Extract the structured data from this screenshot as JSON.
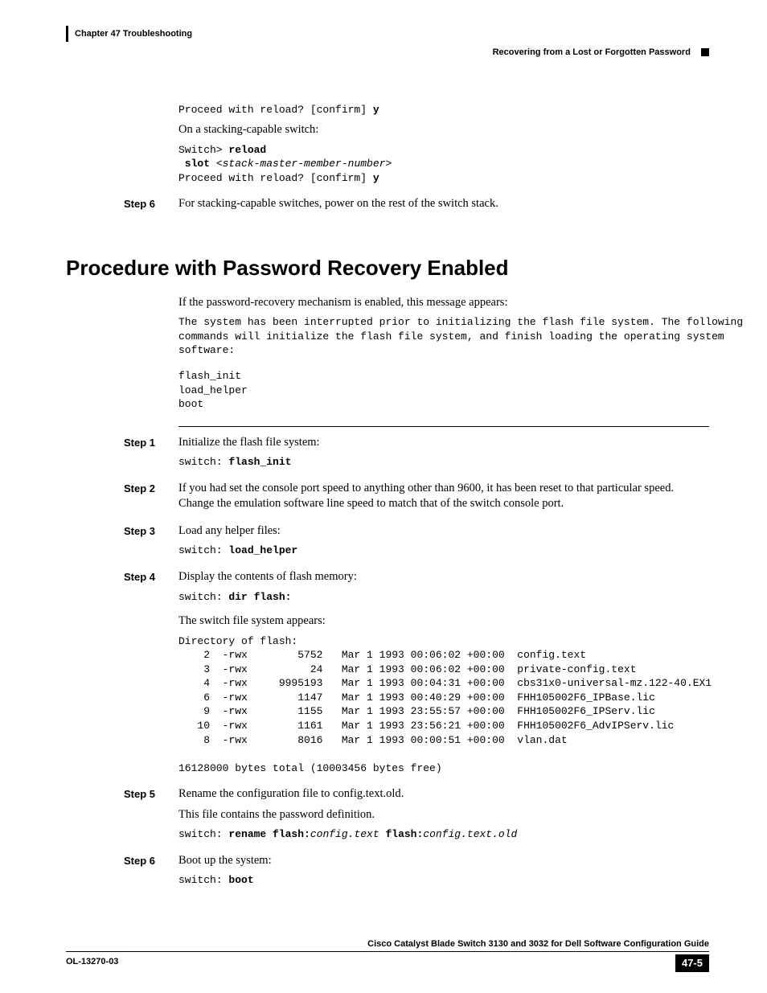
{
  "header": {
    "chapter": "Chapter 47    Troubleshooting",
    "section": "Recovering from a Lost or Forgotten Password"
  },
  "intro": {
    "code1_prefix": "Proceed with reload? [confirm] ",
    "code1_bold": "y",
    "text1": "On a stacking-capable switch:",
    "code2_l1a": "Switch> ",
    "code2_l1b": "reload",
    "code2_l2a": " slot ",
    "code2_l2b": "<stack-master-member-number>",
    "code2_l3a": "Proceed with reload? [confirm] ",
    "code2_l3b": "y"
  },
  "topstep6": {
    "label": "Step 6",
    "text": "For stacking-capable switches, power on the rest of the switch stack."
  },
  "sectionTitle": "Procedure with Password Recovery Enabled",
  "enabled": {
    "p1": "If the password-recovery mechanism is enabled, this message appears:",
    "msg": "The system has been interrupted prior to initializing the flash file system. The following\ncommands will initialize the flash file system, and finish loading the operating system\nsoftware:",
    "cmds": "flash_init\nload_helper\nboot"
  },
  "steps": {
    "s1": {
      "label": "Step 1",
      "text": "Initialize the flash file system:",
      "code_a": "switch: ",
      "code_b": "flash_init"
    },
    "s2": {
      "label": "Step 2",
      "text": "If you had set the console port speed to anything other than 9600, it has been reset to that particular speed. Change the emulation software line speed to match that of the switch console port."
    },
    "s3": {
      "label": "Step 3",
      "text": "Load any helper files:",
      "code_a": "switch: ",
      "code_b": "load_helper"
    },
    "s4": {
      "label": "Step 4",
      "text": "Display the contents of flash memory:",
      "code_a": "switch: ",
      "code_b": "dir flash:",
      "text2": "The switch file system appears:",
      "listing": "Directory of flash:\n    2  -rwx        5752   Mar 1 1993 00:06:02 +00:00  config.text\n    3  -rwx          24   Mar 1 1993 00:06:02 +00:00  private-config.text\n    4  -rwx     9995193   Mar 1 1993 00:04:31 +00:00  cbs31x0-universal-mz.122-40.EX1\n    6  -rwx        1147   Mar 1 1993 00:40:29 +00:00  FHH105002F6_IPBase.lic\n    9  -rwx        1155   Mar 1 1993 23:55:57 +00:00  FHH105002F6_IPServ.lic\n   10  -rwx        1161   Mar 1 1993 23:56:21 +00:00  FHH105002F6_AdvIPServ.lic\n    8  -rwx        8016   Mar 1 1993 00:00:51 +00:00  vlan.dat\n\n16128000 bytes total (10003456 bytes free)"
    },
    "s5": {
      "label": "Step 5",
      "text": "Rename the configuration file to config.text.old.",
      "text2": "This file contains the password definition.",
      "code_a": "switch: ",
      "code_b": "rename flash:",
      "code_c": "config.text",
      "code_d": " flash:",
      "code_e": "config.text.old"
    },
    "s6": {
      "label": "Step 6",
      "text": "Boot up the system:",
      "code_a": "switch: ",
      "code_b": "boot"
    }
  },
  "footer": {
    "guide": "Cisco Catalyst Blade Switch 3130 and 3032 for Dell Software Configuration Guide",
    "ol": "OL-13270-03",
    "page": "47-5"
  }
}
